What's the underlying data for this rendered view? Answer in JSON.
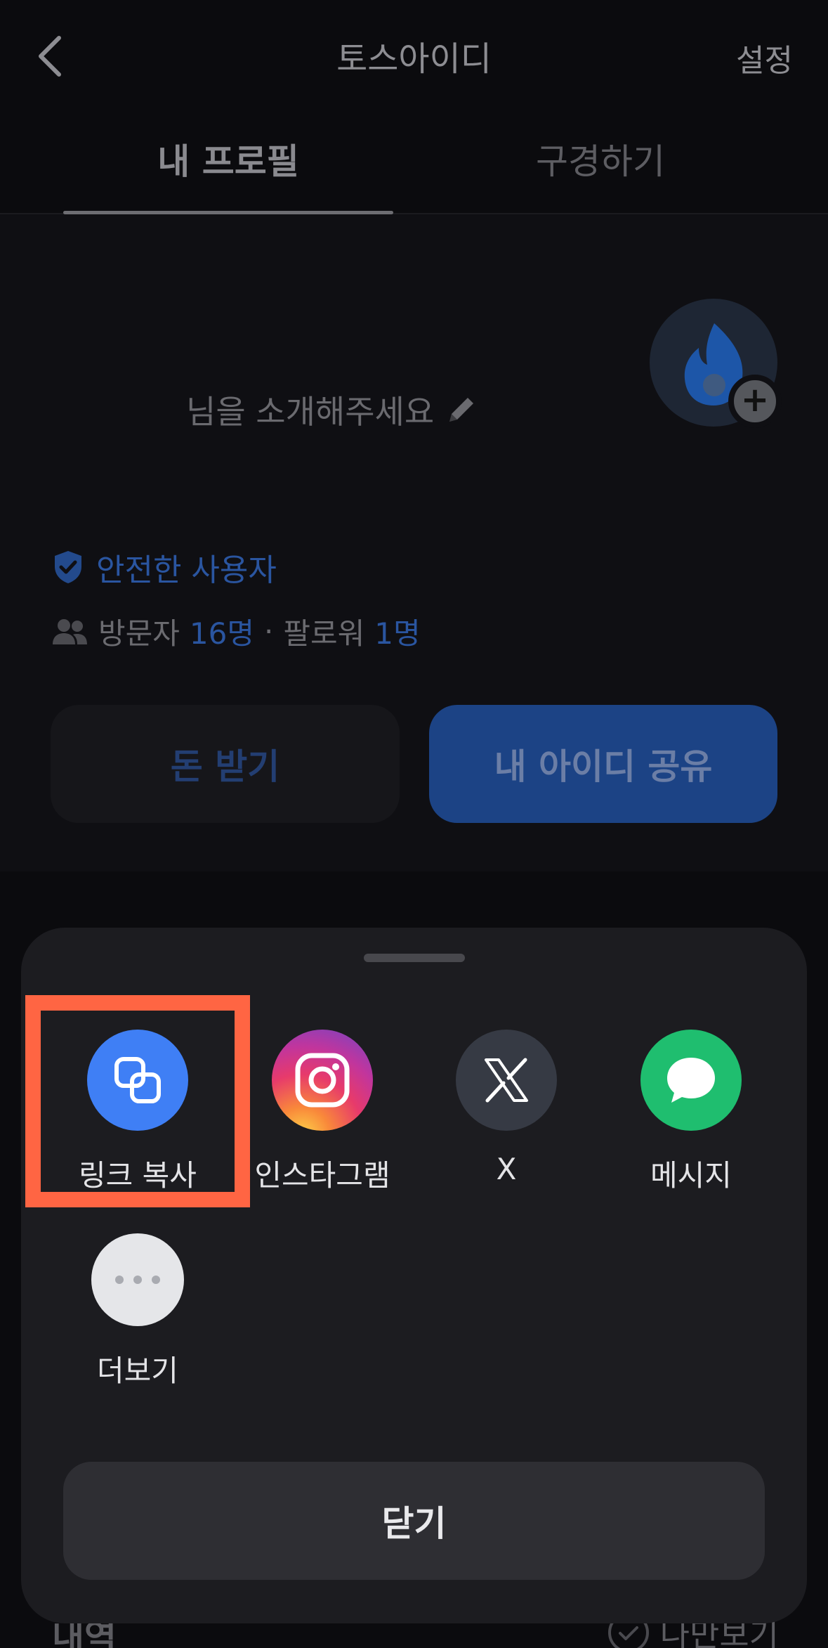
{
  "nav": {
    "back_icon": "chevron-left-icon",
    "title": "토스아이디",
    "settings_label": "설정"
  },
  "tabs": [
    {
      "label": "내 프로필",
      "active": true
    },
    {
      "label": "구경하기",
      "active": false
    }
  ],
  "profile": {
    "intro_placeholder": "님을 소개해주세요",
    "edit_icon": "pencil-icon",
    "avatar_icon": "flame-icon",
    "add_photo_icon": "plus-icon",
    "safe_badge": "안전한 사용자",
    "visitors_label": "방문자",
    "visitors_count": "16명",
    "separator": "·",
    "followers_label": "팔로워",
    "followers_count": "1명",
    "receive_money_label": "돈 받기",
    "share_id_label": "내 아이디 공유"
  },
  "history": {
    "title": "내역",
    "only_me_label": "나만보기"
  },
  "share_sheet": {
    "items": [
      {
        "label": "링크 복사",
        "icon": "copy-link-icon",
        "color": "#3f7ff5"
      },
      {
        "label": "인스타그램",
        "icon": "instagram-icon",
        "color": "#e73a6b"
      },
      {
        "label": "X",
        "icon": "x-logo-icon",
        "color": "#363a44"
      },
      {
        "label": "메시지",
        "icon": "message-bubble-icon",
        "color": "#1fbe6f"
      },
      {
        "label": "더보기",
        "icon": "more-dots-icon",
        "color": "#e5e6e9"
      }
    ],
    "close_label": "닫기"
  },
  "colors": {
    "accent_blue": "#3182f6",
    "highlight": "#ff6543",
    "sheet_bg": "#1c1c20"
  }
}
